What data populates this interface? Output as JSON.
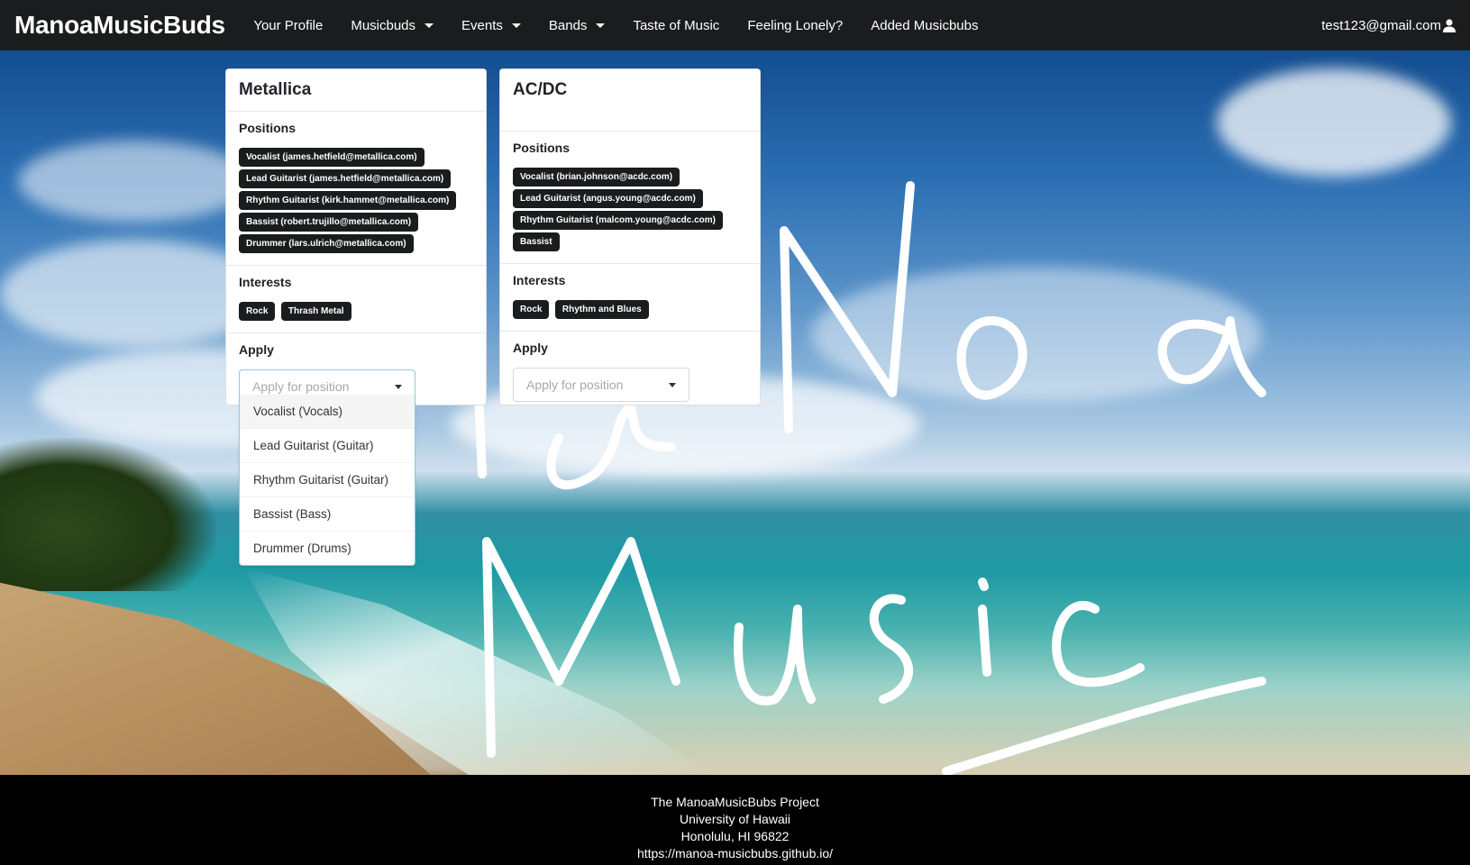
{
  "navbar": {
    "brand": "ManoaMusicBuds",
    "items": [
      {
        "label": "Your Profile",
        "dropdown": false
      },
      {
        "label": "Musicbuds",
        "dropdown": true
      },
      {
        "label": "Events",
        "dropdown": true
      },
      {
        "label": "Bands",
        "dropdown": true
      },
      {
        "label": "Taste of Music",
        "dropdown": false
      },
      {
        "label": "Feeling Lonely?",
        "dropdown": false
      },
      {
        "label": "Added Musicbubs",
        "dropdown": false
      }
    ],
    "user_email": "test123@gmail.com",
    "user_icon": "user-icon"
  },
  "cards": [
    {
      "title": "Metallica",
      "positions_heading": "Positions",
      "positions": [
        "Vocalist (james.hetfield@metallica.com)",
        "Lead Guitarist (james.hetfield@metallica.com)",
        "Rhythm Guitarist (kirk.hammet@metallica.com)",
        "Bassist (robert.trujillo@metallica.com)",
        "Drummer (lars.ulrich@metallica.com)"
      ],
      "interests_heading": "Interests",
      "interests": [
        "Rock",
        "Thrash Metal"
      ],
      "apply_heading": "Apply",
      "apply_placeholder": "Apply for position"
    },
    {
      "title": "AC/DC",
      "positions_heading": "Positions",
      "positions": [
        "Vocalist (brian.johnson@acdc.com)",
        "Lead Guitarist (angus.young@acdc.com)",
        "Rhythm Guitarist (malcom.young@acdc.com)",
        "Bassist"
      ],
      "interests_heading": "Interests",
      "interests": [
        "Rock",
        "Rhythm and Blues"
      ],
      "apply_heading": "Apply",
      "apply_placeholder": "Apply for position"
    }
  ],
  "dropdown_menu": {
    "options": [
      "Vocalist (Vocals)",
      "Lead Guitarist (Guitar)",
      "Rhythm Guitarist (Guitar)",
      "Bassist (Bass)",
      "Drummer (Drums)"
    ],
    "hovered_index": 0
  },
  "footer": {
    "line1": "The ManoaMusicBubs Project",
    "line2": "University of Hawaii",
    "line3": "Honolulu, HI 96822",
    "line4": "https://manoa-musicbubs.github.io/"
  },
  "colors": {
    "navbar_bg": "#1b1c1d",
    "chip_bg": "#1b1c1d",
    "dropdown_focus_border": "#96c8da",
    "footer_bg": "#000000"
  }
}
